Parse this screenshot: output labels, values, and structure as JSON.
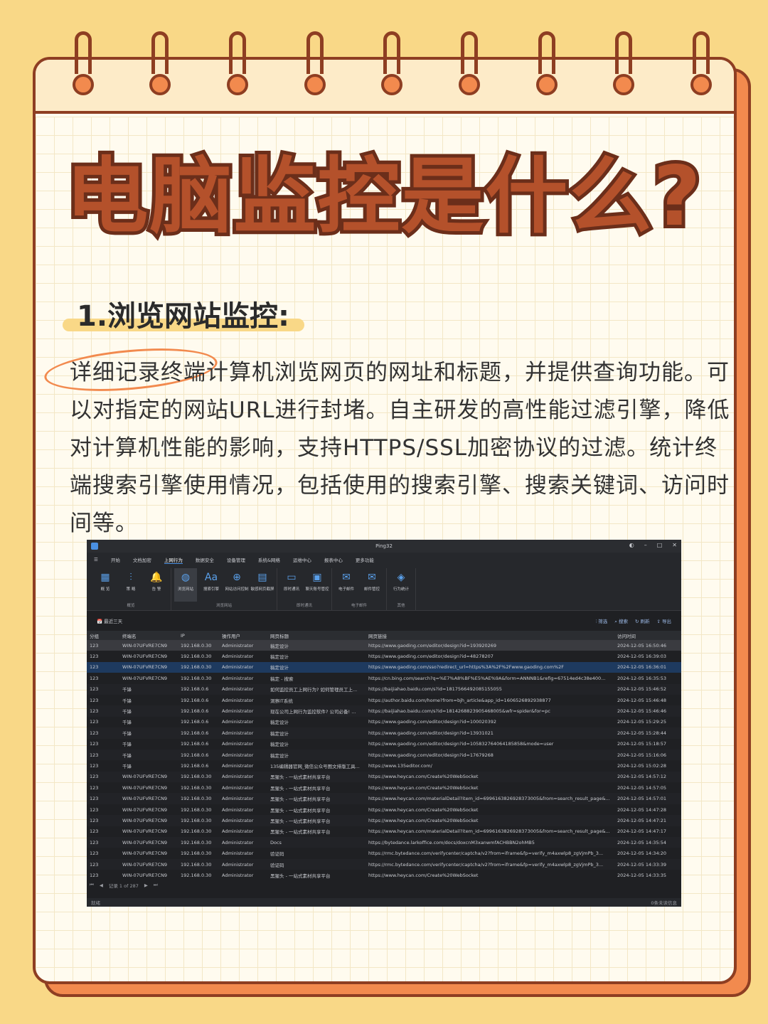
{
  "title": "电脑监控是什么?",
  "section_heading": "1.浏览网站监控:",
  "paragraph": "详细记录终端计算机浏览网页的网址和标题，并提供查询功能。可以对指定的网站URL进行封堵。自主研发的高性能过滤引擎，降低对计算机性能的影响，支持HTTPS/SSL加密协议的过滤。统计终端搜索引擎使用情况，包括使用的搜索引擎、搜索关键词、访问时间等。",
  "app": {
    "window_title": "Ping32",
    "menu": [
      "开始",
      "文档加密",
      "上网行为",
      "数据安全",
      "设备管理",
      "系统&网络",
      "运维中心",
      "报表中心",
      "更多功能"
    ],
    "active_menu": 2,
    "ribbon_groups": [
      {
        "name": "概览",
        "items": [
          {
            "label": "概 览",
            "icon": "grid-icon"
          },
          {
            "label": "策 略",
            "icon": "sliders-icon"
          },
          {
            "label": "告 警",
            "icon": "bell-icon"
          }
        ]
      },
      {
        "name": "浏览网站",
        "items": [
          {
            "label": "浏览网站",
            "icon": "globe-icon"
          },
          {
            "label": "搜索引擎",
            "icon": "font-icon"
          },
          {
            "label": "网站访问控制",
            "icon": "globe-grid-icon"
          },
          {
            "label": "敏感网页截屏",
            "icon": "screenshot-icon"
          }
        ]
      },
      {
        "name": "即时通讯",
        "items": [
          {
            "label": "即时通讯",
            "icon": "chat-icon"
          },
          {
            "label": "聊天账号管控",
            "icon": "chat-lock-icon"
          }
        ]
      },
      {
        "name": "电子邮件",
        "items": [
          {
            "label": "电子邮件",
            "icon": "mail-icon"
          },
          {
            "label": "邮件管控",
            "icon": "mail-lock-icon"
          }
        ]
      },
      {
        "name": "其他",
        "items": [
          {
            "label": "行为统计",
            "icon": "stats-icon"
          }
        ]
      }
    ],
    "filter_label": "最近三天",
    "actions": [
      "筛选",
      "搜索",
      "刷新",
      "导出"
    ],
    "columns": [
      "分组",
      "终端名",
      "IP",
      "操作用户",
      "网页标题",
      "网页链接",
      "访问时间"
    ],
    "rows": [
      [
        "123",
        "WIN-07UFVRE7CN9",
        "192.168.0.30",
        "Administrator",
        "稿定设计",
        "https://www.gaoding.com/editor/design?id=193920269",
        "2024-12-05 16:50:46"
      ],
      [
        "123",
        "WIN-07UFVRE7CN9",
        "192.168.0.30",
        "Administrator",
        "稿定设计",
        "https://www.gaoding.com/editor/design?id=48278207",
        "2024-12-05 16:39:03"
      ],
      [
        "123",
        "WIN-07UFVRE7CN9",
        "192.168.0.30",
        "Administrator",
        "稿定设计",
        "https://www.gaoding.com/sso?redirect_url=https%3A%2F%2Fwww.gaoding.com%2F",
        "2024-12-05 16:36:01"
      ],
      [
        "123",
        "WIN-07UFVRE7CN9",
        "192.168.0.30",
        "Administrator",
        "稿定 - 搜索",
        "https://cn.bing.com/search?q=%E7%A8%BF%E5%AE%9A&form=ANNNB1&refig=67514ed4c38e400...",
        "2024-12-05 16:35:53"
      ],
      [
        "123",
        "千锋",
        "192.168.0.6",
        "Administrator",
        "如何监控员工上网行为? 如何管理员工上...",
        "https://baijiahao.baidu.com/s?id=1817566492085155055",
        "2024-12-05 15:46:52"
      ],
      [
        "123",
        "千锋",
        "192.168.0.6",
        "Administrator",
        "洞察IT系统",
        "https://author.baidu.com/home?from=bjh_article&app_id=1606526892938877",
        "2024-12-05 15:46:48"
      ],
      [
        "123",
        "千锋",
        "192.168.0.6",
        "Administrator",
        "现在公司上网行为监控软件? 公司必备! ...",
        "https://baijiahao.baidu.com/s?id=1814268823905468005&wfr=spider&for=pc",
        "2024-12-05 15:46:46"
      ],
      [
        "123",
        "千锋",
        "192.168.0.6",
        "Administrator",
        "稿定设计",
        "https://www.gaoding.com/editor/design?id=100020392",
        "2024-12-05 15:29:25"
      ],
      [
        "123",
        "千锋",
        "192.168.0.6",
        "Administrator",
        "稿定设计",
        "https://www.gaoding.com/editor/design?id=13931021",
        "2024-12-05 15:28:44"
      ],
      [
        "123",
        "千锋",
        "192.168.0.6",
        "Administrator",
        "稿定设计",
        "https://www.gaoding.com/editor/design?id=105832764064185858&mode=user",
        "2024-12-05 15:18:57"
      ],
      [
        "123",
        "千锋",
        "192.168.0.6",
        "Administrator",
        "稿定设计",
        "https://www.gaoding.com/editor/design?id=17679268",
        "2024-12-05 15:16:06"
      ],
      [
        "123",
        "千锋",
        "192.168.0.6",
        "Administrator",
        "135编辑器官网_微信公众号图文排版工具...",
        "https://www.135editor.com/",
        "2024-12-05 15:02:28"
      ],
      [
        "123",
        "WIN-07UFVRE7CN9",
        "192.168.0.30",
        "Administrator",
        "黑猩头 - 一站式素材共享平台",
        "https://www.heycan.com/Create%20WebSocket",
        "2024-12-05 14:57:12"
      ],
      [
        "123",
        "WIN-07UFVRE7CN9",
        "192.168.0.30",
        "Administrator",
        "黑猩头 - 一站式素材共享平台",
        "https://www.heycan.com/Create%20WebSocket",
        "2024-12-05 14:57:05"
      ],
      [
        "123",
        "WIN-07UFVRE7CN9",
        "192.168.0.30",
        "Administrator",
        "黑猩头 - 一站式素材共享平台",
        "https://www.heycan.com/materialDetail?item_id=6996163826928373005&from=search_result_page&...",
        "2024-12-05 14:57:01"
      ],
      [
        "123",
        "WIN-07UFVRE7CN9",
        "192.168.0.30",
        "Administrator",
        "黑猩头 - 一站式素材共享平台",
        "https://www.heycan.com/Create%20WebSocket",
        "2024-12-05 14:47:28"
      ],
      [
        "123",
        "WIN-07UFVRE7CN9",
        "192.168.0.30",
        "Administrator",
        "黑猩头 - 一站式素材共享平台",
        "https://www.heycan.com/Create%20WebSocket",
        "2024-12-05 14:47:21"
      ],
      [
        "123",
        "WIN-07UFVRE7CN9",
        "192.168.0.30",
        "Administrator",
        "黑猩头 - 一站式素材共享平台",
        "https://www.heycan.com/materialDetail?item_id=6996163826928373005&from=search_result_page&...",
        "2024-12-05 14:47:17"
      ],
      [
        "123",
        "WIN-07UFVRE7CN9",
        "192.168.0.30",
        "Administrator",
        "Docs",
        "https://bytedance.larkoffice.com/docs/doxcnM3xanwmfACHBBN2ohMB5",
        "2024-12-05 14:35:54"
      ],
      [
        "123",
        "WIN-07UFVRE7CN9",
        "192.168.0.30",
        "Administrator",
        "验证码",
        "https://rmc.bytedance.com/verifycenter/captcha/v2?from=iframe&fp=verify_m4axwlp8_zgVjmPb_3...",
        "2024-12-05 14:34:20"
      ],
      [
        "123",
        "WIN-07UFVRE7CN9",
        "192.168.0.30",
        "Administrator",
        "验证码",
        "https://rmc.bytedance.com/verifycenter/captcha/v2?from=iframe&fp=verify_m4axwlp8_zgVjmPb_3...",
        "2024-12-05 14:33:39"
      ],
      [
        "123",
        "WIN-07UFVRE7CN9",
        "192.168.0.30",
        "Administrator",
        "黑猩头 - 一站式素材共享平台",
        "https://www.heycan.com/Create%20WebSocket",
        "2024-12-05 14:33:35"
      ]
    ],
    "pager": "记录 1 of 287",
    "status_left": "就绪",
    "status_right": "0条未读信息"
  }
}
